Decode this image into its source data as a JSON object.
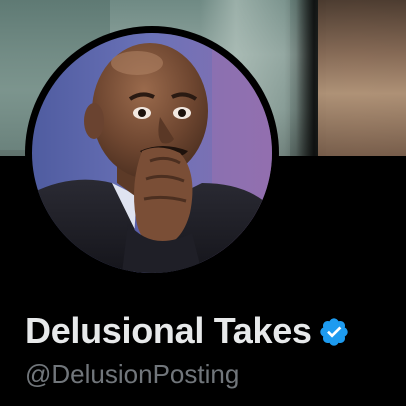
{
  "profile": {
    "display_name": "Delusional Takes",
    "handle": "@DelusionPosting",
    "verified": true,
    "avatar_icon": "profile-photo",
    "verified_icon": "verified-check-badge-icon"
  },
  "colors": {
    "background": "#000000",
    "name_text": "#e7e9ea",
    "handle_text": "#71767b",
    "verified_badge": "#1d9bf0"
  }
}
